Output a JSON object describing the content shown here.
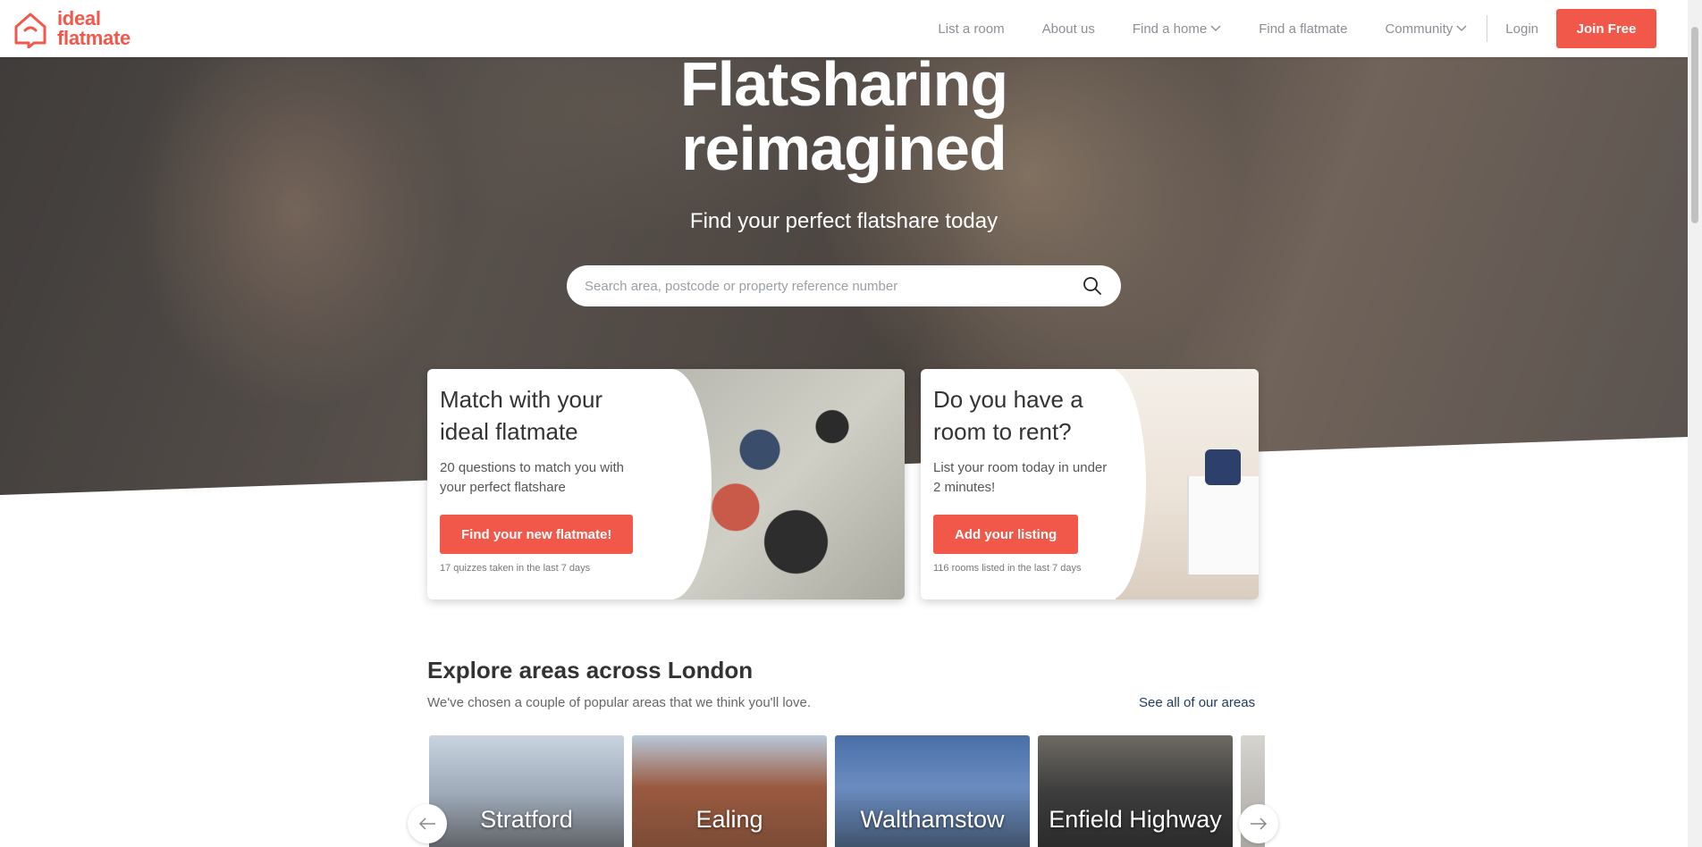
{
  "brand": {
    "name_line1": "ideal",
    "name_line2": "flatmate",
    "accent_color": "#f2584a"
  },
  "nav": {
    "items": [
      {
        "label": "List a room",
        "has_dropdown": false
      },
      {
        "label": "About us",
        "has_dropdown": false
      },
      {
        "label": "Find a home",
        "has_dropdown": true
      },
      {
        "label": "Find a flatmate",
        "has_dropdown": false
      },
      {
        "label": "Community",
        "has_dropdown": true
      }
    ],
    "login_label": "Login",
    "join_label": "Join Free"
  },
  "hero": {
    "title_line1": "Flatsharing",
    "title_line2": "reimagined",
    "subtitle": "Find your perfect flatshare today",
    "search_placeholder": "Search area, postcode or property reference number",
    "search_icon": "search-icon"
  },
  "cards": [
    {
      "title_line1": "Match with your",
      "title_line2": "ideal flatmate",
      "desc_line1": "20 questions to match you with",
      "desc_line2": "your perfect flatshare",
      "button_label": "Find your new flatmate!",
      "meta": "17 quizzes taken in the last 7 days"
    },
    {
      "title_line1": "Do you have a",
      "title_line2": "room to rent?",
      "desc_line1": "List your room today in under",
      "desc_line2": "2 minutes!",
      "button_label": "Add your listing",
      "meta": "116 rooms listed in the last 7 days"
    }
  ],
  "explore": {
    "title": "Explore areas across London",
    "subtitle": "We've chosen a couple of popular areas that we think you'll love.",
    "see_all_label": "See all of our areas",
    "areas": [
      "Stratford",
      "Ealing",
      "Walthamstow",
      "Enfield Highway",
      ""
    ]
  }
}
